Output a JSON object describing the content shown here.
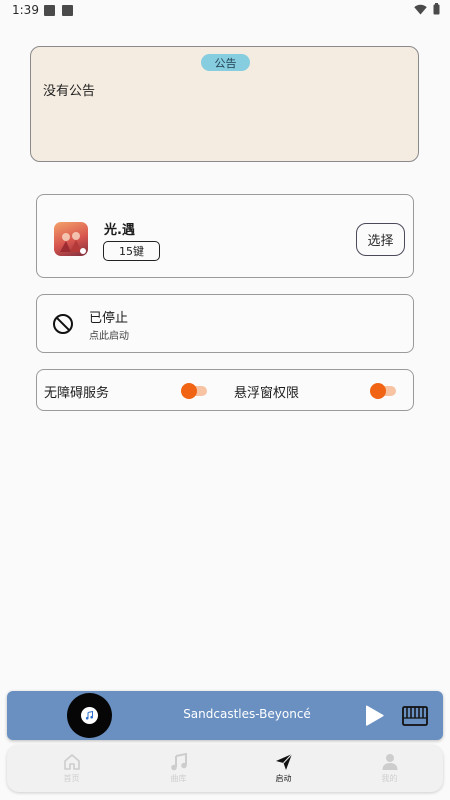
{
  "status_bar": {
    "time": "1:39"
  },
  "notice": {
    "badge": "公告",
    "body": "没有公告"
  },
  "game": {
    "title": "光.遇",
    "keys": "15键",
    "select_label": "选择"
  },
  "service_status": {
    "title": "已停止",
    "subtitle": "点此启动"
  },
  "permissions": {
    "accessibility_label": "无障碍服务",
    "overlay_label": "悬浮窗权限"
  },
  "player": {
    "song": "Sandcastles-Beyoncé"
  },
  "nav": {
    "items": [
      {
        "label": "首页",
        "icon": "home-icon"
      },
      {
        "label": "曲库",
        "icon": "music-note-icon"
      },
      {
        "label": "启动",
        "icon": "paper-plane-icon",
        "active": true
      },
      {
        "label": "我的",
        "icon": "person-icon"
      }
    ]
  },
  "colors": {
    "accent_orange": "#f06414",
    "player_bg": "#6a90c2",
    "notice_bg": "#f4ece0",
    "badge_bg": "#86cde0"
  }
}
